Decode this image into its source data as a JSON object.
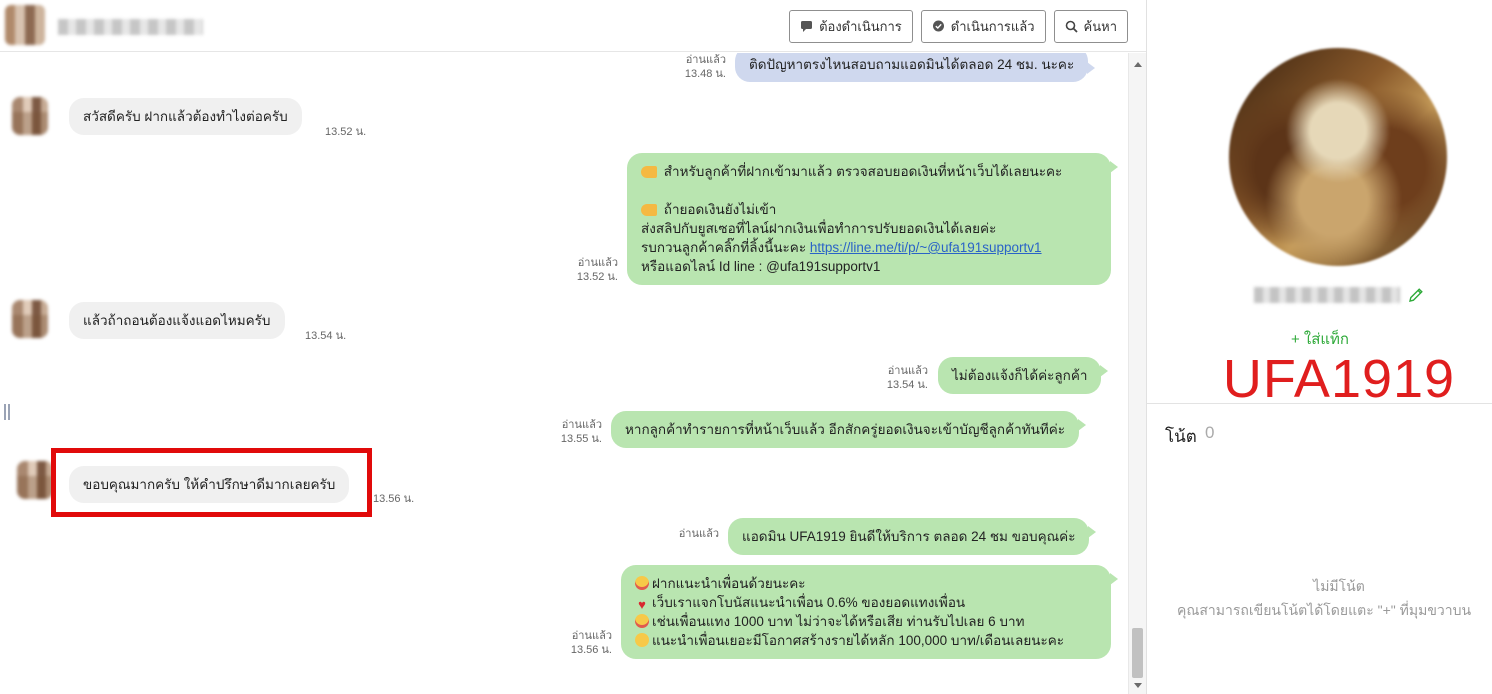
{
  "header": {
    "contact_name": "",
    "buttons": {
      "pending": "ต้องดำเนินการ",
      "done": "ดำเนินการแล้ว",
      "search": "ค้นหา"
    }
  },
  "messages": [
    {
      "dir": "out",
      "text": "ติดปัญหาตรงไหนสอบถามแอดมินได้ตลอด 24 ชม. นะคะ",
      "status": "อ่านแล้ว",
      "time": "13.48 น."
    },
    {
      "dir": "in",
      "text": "สวัสดีครับ ฝากแล้วต้องทำไงต่อครับ",
      "time": "13.52 น."
    },
    {
      "dir": "out",
      "status": "อ่านแล้ว",
      "time": "13.52 น.",
      "line1": "สำหรับลูกค้าที่ฝากเข้ามาแล้ว ตรวจสอบยอดเงินที่หน้าเว็บได้เลยนะคะ",
      "line2": "ถ้ายอดเงินยังไม่เข้า",
      "line3": "ส่งสลิปกับยูสเซอที่ไลน์ฝากเงินเพื่อทำการปรับยอดเงินได้เลยค่ะ",
      "line4_prefix": "รบกวนลูกค้าคลิ๊กที่ลิ้งนี้นะคะ ",
      "line4_link": "https://line.me/ti/p/~@ufa191supportv1",
      "line5": "หรือแอดไลน์ Id line : @ufa191supportv1"
    },
    {
      "dir": "in",
      "text": "แล้วถ้าถอนต้องแจ้งแอดไหมครับ",
      "time": "13.54 น."
    },
    {
      "dir": "out",
      "text": "ไม่ต้องแจ้งก็ได้ค่ะลูกค้า",
      "status": "อ่านแล้ว",
      "time": "13.54 น."
    },
    {
      "dir": "out",
      "text": "หากลูกค้าทำรายการที่หน้าเว็บแล้ว อีกสักครู่ยอดเงินจะเข้าบัญชีลูกค้าทันทีค่ะ",
      "status": "อ่านแล้ว",
      "time": "13.55 น."
    },
    {
      "dir": "in",
      "text": "ขอบคุณมากครับ ให้คำปรึกษาดีมากเลยครับ",
      "time": "13.56 น."
    },
    {
      "dir": "out",
      "text": "แอดมิน UFA1919 ยินดีให้บริการ ตลอด 24 ชม ขอบคุณค่ะ",
      "status": "อ่านแล้ว"
    },
    {
      "dir": "out",
      "status": "อ่านแล้ว",
      "time": "13.56 น.",
      "line1": "ฝากแนะนำเพื่อนด้วยนะคะ",
      "line2": "เว็บเราแจกโบนัสแนะนำเพื่อน 0.6% ของยอดแทงเพื่อน",
      "line3": "เช่นเพื่อนแทง 1000 บาท ไม่ว่าจะได้หรือเสีย ท่านรับไปเลย 6 บาท",
      "line4": "แนะนำเพื่อนเยอะมีโอกาศสร้างรายได้หลัก 100,000 บาท/เดือนเลยนะคะ"
    }
  ],
  "profile": {
    "add_tag": "+ ใส่แท็ก",
    "brand": "UFA1919",
    "note_label": "โน้ต",
    "note_count": "0",
    "note_empty_title": "ไม่มีโน้ต",
    "note_empty_desc": "คุณสามารถเขียนโน้ตได้โดยแตะ \"+\" ที่มุมขวาบน"
  },
  "colors": {
    "outgoing_bubble": "#b9e5b0",
    "incoming_bubble": "#f0f0f0",
    "highlight": "#e10a0a",
    "brand": "#e01e1e",
    "add_tag": "#2faa3a"
  }
}
